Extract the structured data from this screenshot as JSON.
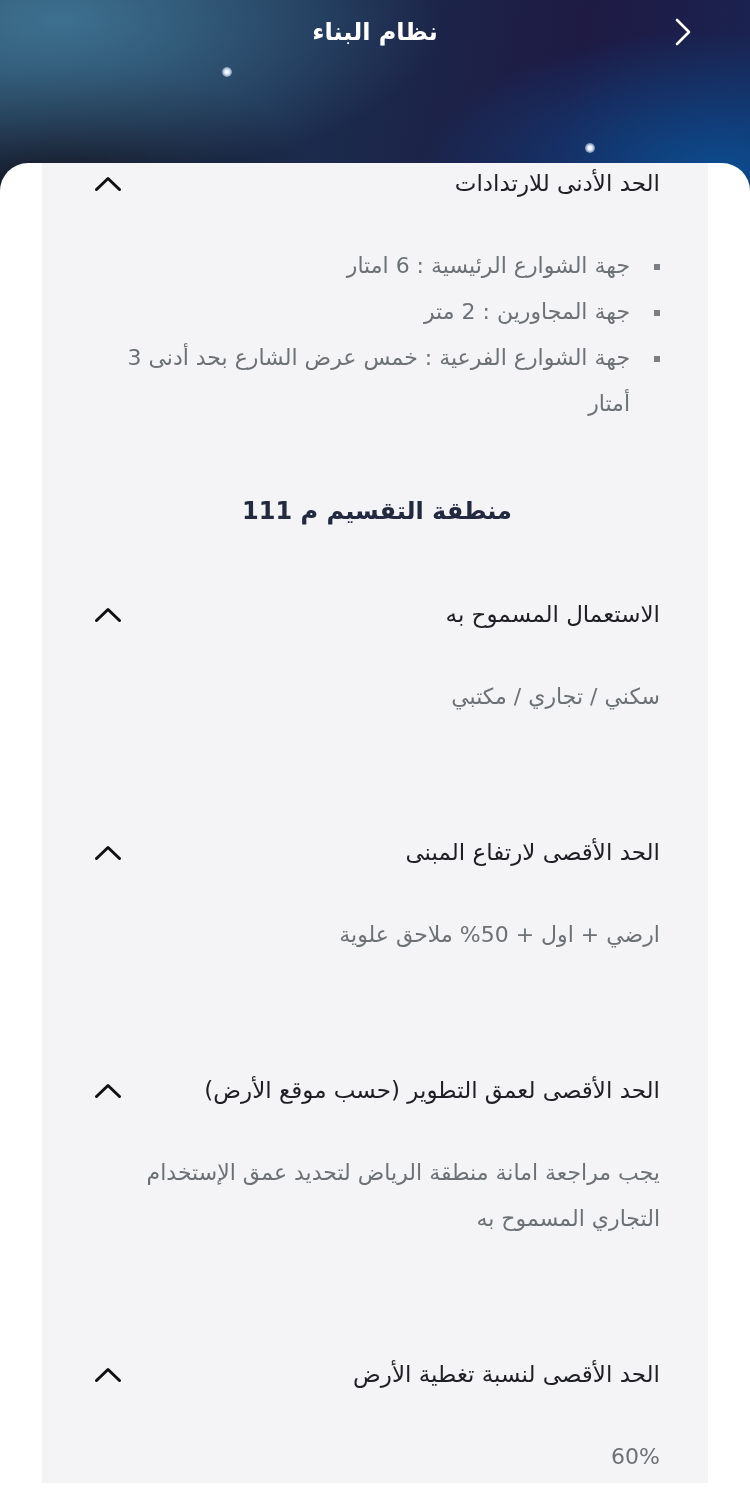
{
  "header": {
    "title": "نظام البناء"
  },
  "sections": [
    {
      "kind": "accordion",
      "title": "الحد الأدنى للارتدادات",
      "expanded": true,
      "body": {
        "kind": "list",
        "items": [
          "جهة الشوارع الرئيسية : 6 امتار",
          "جهة المجاورين : 2 متر",
          "جهة الشوارع الفرعية : خمس عرض الشارع بحد أدنى 3 أمتار"
        ]
      }
    },
    {
      "kind": "heading",
      "text": "منطقة التقسيم م 111"
    },
    {
      "kind": "accordion",
      "title": "الاستعمال المسموح به",
      "expanded": true,
      "body": {
        "kind": "text",
        "text": "سكني / تجاري / مكتبي"
      }
    },
    {
      "kind": "accordion",
      "title": "الحد الأقصى لارتفاع المبنى",
      "expanded": true,
      "body": {
        "kind": "text",
        "text": "ارضي + اول + 50% ملاحق علوية"
      }
    },
    {
      "kind": "accordion",
      "title": "الحد الأقصى لعمق التطوير (حسب موقع الأرض)",
      "expanded": true,
      "body": {
        "kind": "text",
        "text": "يجب مراجعة امانة منطقة الرياض لتحديد عمق الإستخدام التجاري المسموح به"
      }
    },
    {
      "kind": "accordion",
      "title": "الحد الأقصى لنسبة تغطية الأرض",
      "expanded": true,
      "body": {
        "kind": "text",
        "text": "60%"
      }
    }
  ]
}
